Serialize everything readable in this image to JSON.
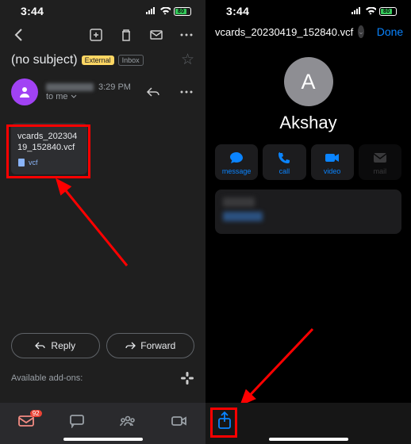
{
  "status": {
    "time": "3:44",
    "battery": "80"
  },
  "email": {
    "subject": "(no subject)",
    "badge_external": "External",
    "badge_inbox": "Inbox",
    "sender_time": "3:29 PM",
    "recipient": "to me",
    "attachment": {
      "name": "vcards_20230419_152840.vcf",
      "type": "vcf"
    },
    "reply": "Reply",
    "forward": "Forward",
    "addons": "Available add-ons:",
    "nav_badge": "92"
  },
  "contact": {
    "filename": "vcards_20230419_152840.vcf",
    "done": "Done",
    "initial": "A",
    "name": "Akshay",
    "actions": {
      "message": "message",
      "call": "call",
      "video": "video",
      "mail": "mail"
    }
  }
}
